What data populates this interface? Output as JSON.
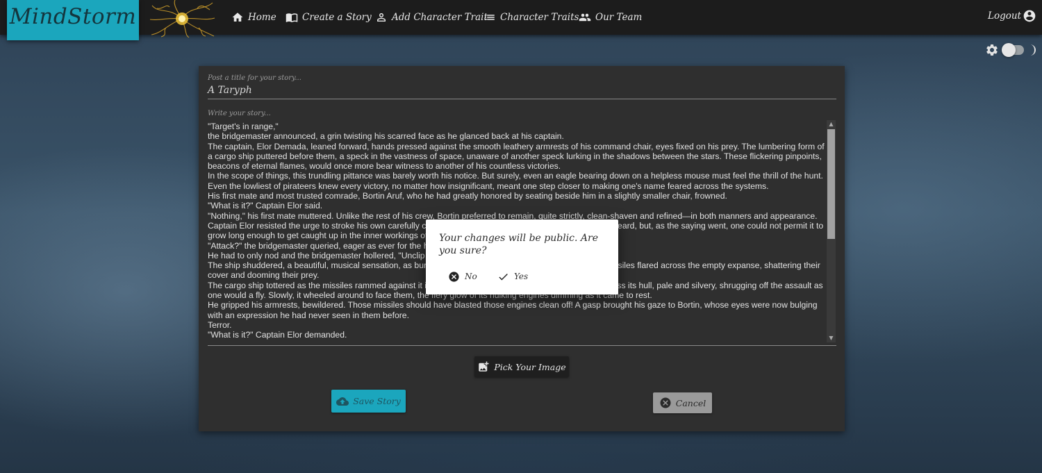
{
  "nav": {
    "brand": "MindStorm",
    "items": [
      {
        "label": "Home",
        "icon": "home-icon"
      },
      {
        "label": "Create a Story",
        "icon": "book-icon"
      },
      {
        "label": "Add Character Trait",
        "icon": "person-icon"
      },
      {
        "label": "Character Traits",
        "icon": "list-icon"
      },
      {
        "label": "Our Team",
        "icon": "group-icon"
      }
    ],
    "logout": "Logout"
  },
  "form": {
    "title_label": "Post a title for your story...",
    "title_value": "A Taryph",
    "story_label": "Write your story...",
    "story_lines": [
      "\"Target's in range,\"",
      "the bridgemaster announced, a grin twisting his scarred face as he glanced back at his captain.",
      "The captain, Elor Demada, leaned forward, hands pressed against the smooth leathery armrests of his command chair, eyes fixed on his prey. The lumbering form of a cargo ship puttered before them, a speck in the vastness of space, unaware of another speck lurking in the shadows between the stars. These flickering pinpoints, beacons of eternal flames, would once more bear witness to another of his countless victories.",
      "In the scope of things, this trundling pittance was barely worth his notice. But surely, even an eagle bearing down on a helpless mouse must feel the thrill of the hunt. Even the lowliest of pirateers knew every victory, no matter how insignificant, meant one step closer to making one's name feared across the systems.",
      "His first mate and most trusted comrade, Bortin Aruf, who he had greatly honored by seating beside him in a slightly smaller chair, frowned.",
      "\"What is it?\" Captain Elor said.",
      "\"Nothing,\" his first mate muttered. Unlike the rest of his crew, Bortin preferred to remain, quite strictly, clean-shaven and refined—in both manners and appearance.",
      "Captain Elor resisted the urge to stroke his own carefully cultivated beard. It was a fine beard, a magnificent beard, but, as the saying went, one could not permit it to grow long enough to get caught up in the inner workings of a blaster.",
      "\"Attack?\" the bridgemaster queried, eager as ever for the hunt.",
      "He had to only nod and the bridgemaster hollered, \"Unclip the missiles!\"",
      "The ship shuddered, a beautiful, musical sensation, as bursts of white-hot fire erupted from its flanks. The missiles flared across the empty expanse, shattering their cover and dooming their prey.",
      "The cargo ship tottered as the missiles rammed against it in a hail of explosions. But something flickered across its hull, pale and silvery, shrugging off the assault as one would a fly. Slowly, it wheeled around to face them, the fiery glow of its hulking engines dimming as it came to rest.",
      "He gripped his armrests, bewildered. Those missiles should have blasted those engines clean off! A gasp brought his gaze to Bortin, whose eyes were now bulging with an expression he had never seen in them before.",
      "Terror.",
      "\"What is it?\" Captain Elor demanded."
    ],
    "pick_image_label": "Pick Your Image",
    "save_label": "Save Story",
    "cancel_label": "Cancel"
  },
  "dialog": {
    "message": "Your changes will be public. Are you sure?",
    "no_label": "No",
    "yes_label": "Yes"
  },
  "colors": {
    "accent": "#1ba6bd",
    "navbar": "#1c1c1c",
    "card": "#2f2f2f"
  }
}
